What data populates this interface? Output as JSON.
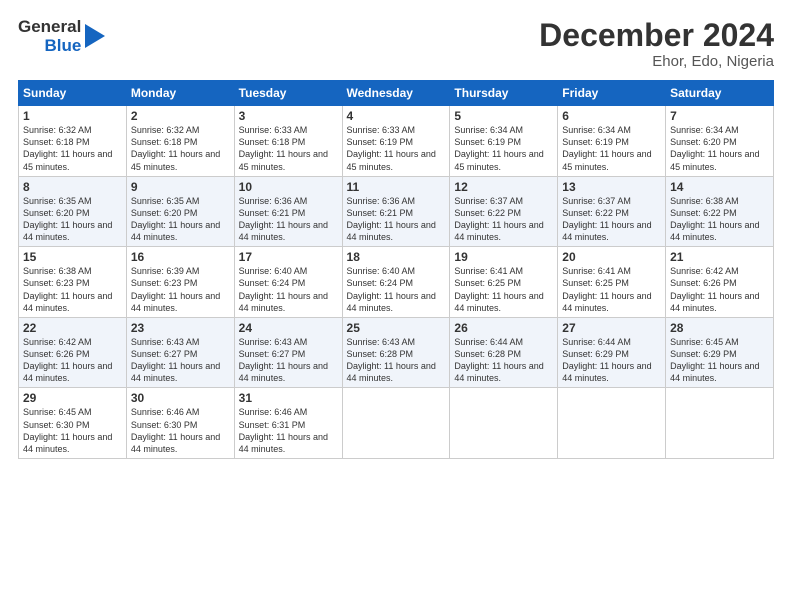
{
  "header": {
    "logo_line1": "General",
    "logo_line2": "Blue",
    "title": "December 2024",
    "subtitle": "Ehor, Edo, Nigeria"
  },
  "calendar": {
    "days_of_week": [
      "Sunday",
      "Monday",
      "Tuesday",
      "Wednesday",
      "Thursday",
      "Friday",
      "Saturday"
    ],
    "weeks": [
      [
        {
          "day": "1",
          "sunrise": "6:32 AM",
          "sunset": "6:18 PM",
          "daylight": "11 hours and 45 minutes."
        },
        {
          "day": "2",
          "sunrise": "6:32 AM",
          "sunset": "6:18 PM",
          "daylight": "11 hours and 45 minutes."
        },
        {
          "day": "3",
          "sunrise": "6:33 AM",
          "sunset": "6:18 PM",
          "daylight": "11 hours and 45 minutes."
        },
        {
          "day": "4",
          "sunrise": "6:33 AM",
          "sunset": "6:19 PM",
          "daylight": "11 hours and 45 minutes."
        },
        {
          "day": "5",
          "sunrise": "6:34 AM",
          "sunset": "6:19 PM",
          "daylight": "11 hours and 45 minutes."
        },
        {
          "day": "6",
          "sunrise": "6:34 AM",
          "sunset": "6:19 PM",
          "daylight": "11 hours and 45 minutes."
        },
        {
          "day": "7",
          "sunrise": "6:34 AM",
          "sunset": "6:20 PM",
          "daylight": "11 hours and 45 minutes."
        }
      ],
      [
        {
          "day": "8",
          "sunrise": "6:35 AM",
          "sunset": "6:20 PM",
          "daylight": "11 hours and 44 minutes."
        },
        {
          "day": "9",
          "sunrise": "6:35 AM",
          "sunset": "6:20 PM",
          "daylight": "11 hours and 44 minutes."
        },
        {
          "day": "10",
          "sunrise": "6:36 AM",
          "sunset": "6:21 PM",
          "daylight": "11 hours and 44 minutes."
        },
        {
          "day": "11",
          "sunrise": "6:36 AM",
          "sunset": "6:21 PM",
          "daylight": "11 hours and 44 minutes."
        },
        {
          "day": "12",
          "sunrise": "6:37 AM",
          "sunset": "6:22 PM",
          "daylight": "11 hours and 44 minutes."
        },
        {
          "day": "13",
          "sunrise": "6:37 AM",
          "sunset": "6:22 PM",
          "daylight": "11 hours and 44 minutes."
        },
        {
          "day": "14",
          "sunrise": "6:38 AM",
          "sunset": "6:22 PM",
          "daylight": "11 hours and 44 minutes."
        }
      ],
      [
        {
          "day": "15",
          "sunrise": "6:38 AM",
          "sunset": "6:23 PM",
          "daylight": "11 hours and 44 minutes."
        },
        {
          "day": "16",
          "sunrise": "6:39 AM",
          "sunset": "6:23 PM",
          "daylight": "11 hours and 44 minutes."
        },
        {
          "day": "17",
          "sunrise": "6:40 AM",
          "sunset": "6:24 PM",
          "daylight": "11 hours and 44 minutes."
        },
        {
          "day": "18",
          "sunrise": "6:40 AM",
          "sunset": "6:24 PM",
          "daylight": "11 hours and 44 minutes."
        },
        {
          "day": "19",
          "sunrise": "6:41 AM",
          "sunset": "6:25 PM",
          "daylight": "11 hours and 44 minutes."
        },
        {
          "day": "20",
          "sunrise": "6:41 AM",
          "sunset": "6:25 PM",
          "daylight": "11 hours and 44 minutes."
        },
        {
          "day": "21",
          "sunrise": "6:42 AM",
          "sunset": "6:26 PM",
          "daylight": "11 hours and 44 minutes."
        }
      ],
      [
        {
          "day": "22",
          "sunrise": "6:42 AM",
          "sunset": "6:26 PM",
          "daylight": "11 hours and 44 minutes."
        },
        {
          "day": "23",
          "sunrise": "6:43 AM",
          "sunset": "6:27 PM",
          "daylight": "11 hours and 44 minutes."
        },
        {
          "day": "24",
          "sunrise": "6:43 AM",
          "sunset": "6:27 PM",
          "daylight": "11 hours and 44 minutes."
        },
        {
          "day": "25",
          "sunrise": "6:43 AM",
          "sunset": "6:28 PM",
          "daylight": "11 hours and 44 minutes."
        },
        {
          "day": "26",
          "sunrise": "6:44 AM",
          "sunset": "6:28 PM",
          "daylight": "11 hours and 44 minutes."
        },
        {
          "day": "27",
          "sunrise": "6:44 AM",
          "sunset": "6:29 PM",
          "daylight": "11 hours and 44 minutes."
        },
        {
          "day": "28",
          "sunrise": "6:45 AM",
          "sunset": "6:29 PM",
          "daylight": "11 hours and 44 minutes."
        }
      ],
      [
        {
          "day": "29",
          "sunrise": "6:45 AM",
          "sunset": "6:30 PM",
          "daylight": "11 hours and 44 minutes."
        },
        {
          "day": "30",
          "sunrise": "6:46 AM",
          "sunset": "6:30 PM",
          "daylight": "11 hours and 44 minutes."
        },
        {
          "day": "31",
          "sunrise": "6:46 AM",
          "sunset": "6:31 PM",
          "daylight": "11 hours and 44 minutes."
        },
        null,
        null,
        null,
        null
      ]
    ]
  }
}
